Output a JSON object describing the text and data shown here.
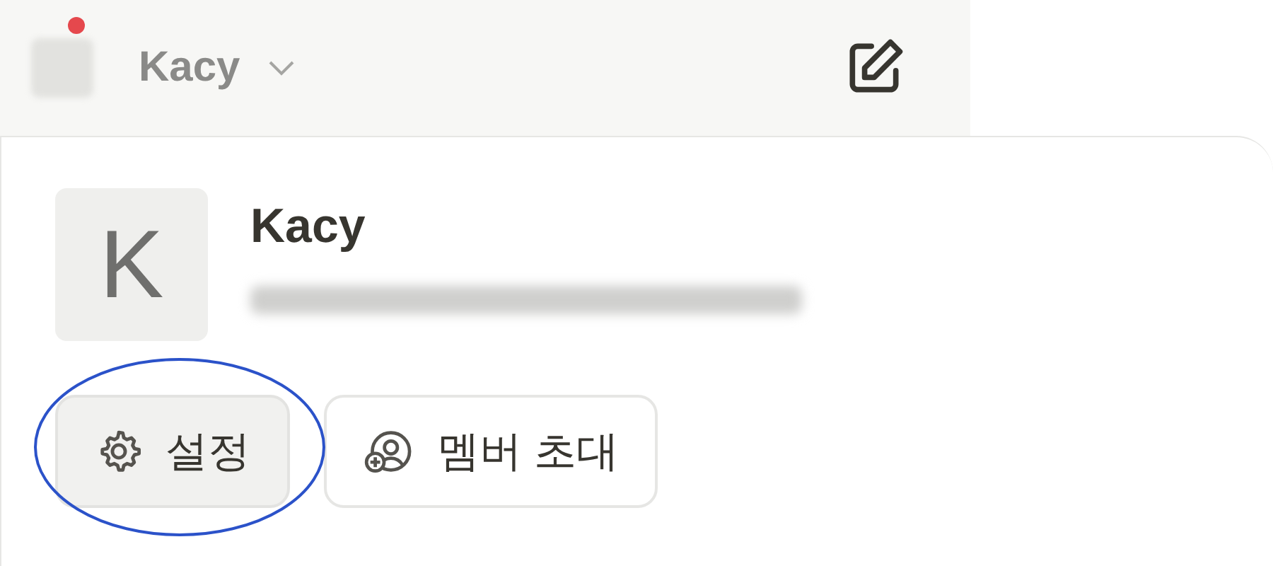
{
  "top_bar": {
    "workspace_name": "Kacy",
    "notification": true
  },
  "profile": {
    "initial": "K",
    "name": "Kacy"
  },
  "buttons": [
    {
      "label": "설정",
      "kind": "settings",
      "selected": true
    },
    {
      "label": "멤버 초대",
      "kind": "invite",
      "selected": false
    }
  ],
  "annotation": {
    "kind": "ellipse"
  }
}
